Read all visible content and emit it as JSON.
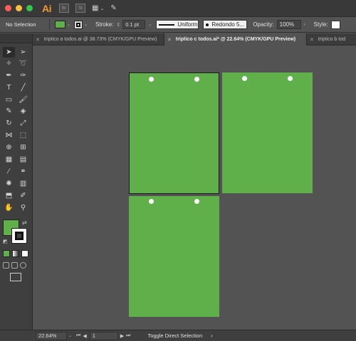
{
  "app": {
    "logo": "Ai",
    "bridge_label": "Br",
    "stock_label": "St",
    "arrange_icon": "grid-arrange-icon",
    "feather_icon": "feather-icon"
  },
  "control_bar": {
    "selection_label": "No Selection",
    "fill_color": "#5fb04a",
    "stroke_label": "Stroke:",
    "stroke_value": "0.1 pt",
    "profile_label": "Uniform",
    "brush_label": "Redondo 5...",
    "opacity_label": "Opacity:",
    "opacity_value": "100%",
    "style_label": "Style:"
  },
  "tabs": [
    {
      "label": "triptico a todos.ai @ 38.73% (CMYK/GPU Preview)",
      "active": false
    },
    {
      "label": "triptico c todos.ai* @ 22.64% (CMYK/GPU Preview)",
      "active": true
    },
    {
      "label": "triptico b tod",
      "active": false
    }
  ],
  "artboards": [
    {
      "name": "artboard-1",
      "color": "#5fb04a",
      "selected": true
    },
    {
      "name": "artboard-2",
      "color": "#5fb04a",
      "selected": false
    },
    {
      "name": "artboard-3",
      "color": "#5fb04a",
      "selected": false
    }
  ],
  "status_bar": {
    "zoom": "22.64%",
    "artboard_number": "1",
    "status_text": "Toggle Direct Selection"
  }
}
